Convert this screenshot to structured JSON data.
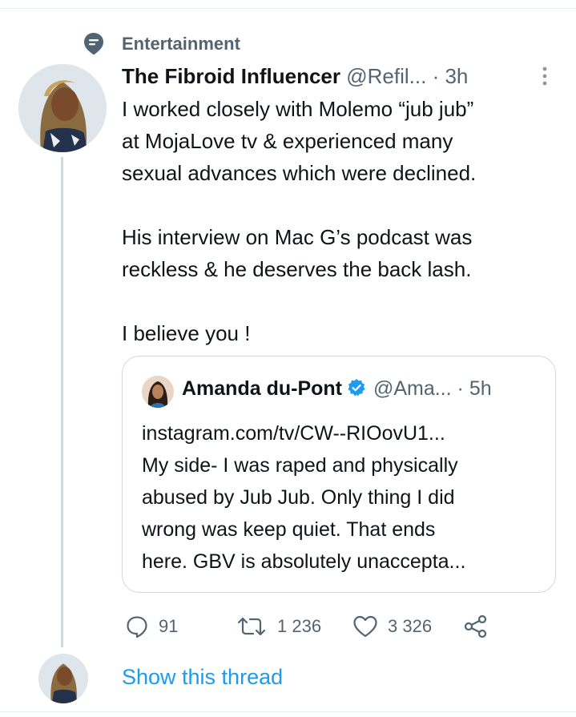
{
  "social_context": {
    "label": "Entertainment",
    "icon": "topic-icon"
  },
  "tweet": {
    "display_name": "The Fibroid Influencer",
    "handle": "@Refil...",
    "separator": "·",
    "time": "3h",
    "text_lines": [
      [
        "I worked closely with Molemo “jub jub”",
        "at MojaLove tv & experienced many",
        "sexual advances which were declined."
      ],
      [
        "His interview on Mac G’s podcast was",
        "reckless & he deserves the back lash."
      ],
      [
        "I believe you !"
      ]
    ]
  },
  "quoted_tweet": {
    "display_name": "Amanda du-Pont",
    "handle": "@Ama...",
    "separator": "·",
    "time": "5h",
    "verified": true,
    "text_lines": [
      "instagram.com/tv/CW--RIOovU1...",
      "My side- I was raped and physically",
      "abused by Jub Jub. Only thing I did",
      "wrong was keep quiet. That ends",
      "here. GBV is absolutely unaccepta..."
    ]
  },
  "actions": {
    "replies": "91",
    "retweets": "1 236",
    "likes": "3 326"
  },
  "show_thread": "Show this thread",
  "colors": {
    "accent": "#1d9bf0",
    "muted": "#536471",
    "border": "#cfd9de",
    "text": "#0f1419"
  }
}
